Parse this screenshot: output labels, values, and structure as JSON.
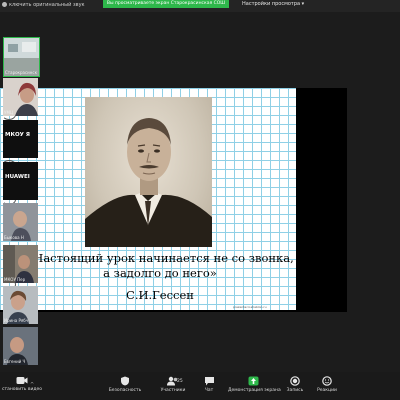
{
  "topbar": {
    "left_text": "ключить оригинальный звук",
    "share_banner": "Вы просматриваете экран Старокрасинская СОШ",
    "view_options": "Настройки просмотра"
  },
  "slide": {
    "quote": "«Настоящий урок начинается не со звонка, а задолго до него»",
    "author": "С.И.Гессен",
    "footnote": "prezentacii-shablon.ru"
  },
  "gallery": [
    {
      "name": "Старокрасинск",
      "label": ""
    },
    {
      "name": "УМЦ",
      "label": ""
    },
    {
      "name": "",
      "label": "МКОУ Я"
    },
    {
      "name": "",
      "label": "HUAWEI"
    },
    {
      "name": "Быкова Н",
      "label": ""
    },
    {
      "name": "МКОУ Пер",
      "label": ""
    },
    {
      "name": "Ирина Рябч",
      "label": ""
    },
    {
      "name": "Евгений Ч",
      "label": ""
    }
  ],
  "bottombar": {
    "video": "становить видео",
    "security": "Безопасность",
    "participants": "Участники",
    "participants_count": "25",
    "chat": "Чат",
    "screen_share": "Демонстрация экрана",
    "record": "Запись",
    "reactions": "Реакции"
  },
  "colors": {
    "share_banner": "#2eb84b",
    "grid_lines": "#8fd0e6",
    "screen_share_icon": "#2eb84b"
  }
}
